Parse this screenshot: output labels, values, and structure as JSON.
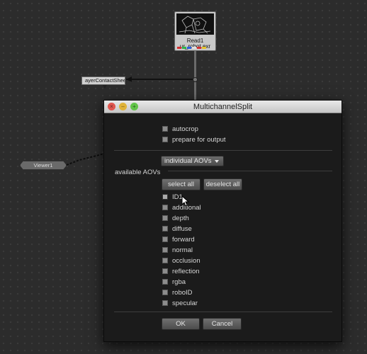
{
  "graph": {
    "read_node": {
      "name": "Read1",
      "file": "ur_robot.exr"
    },
    "contact_node": {
      "label": "ayerContactSheet"
    },
    "viewer_node": {
      "label": "Viewer1"
    },
    "channel_colors": [
      "#d23030",
      "#2fb64a",
      "#2b5fe0",
      "#e0e0e0",
      "#d23030",
      "#e6c42a"
    ]
  },
  "dialog": {
    "title": "MultichannelSplit",
    "options": [
      {
        "label": "autocrop",
        "checked": false
      },
      {
        "label": "prepare for output",
        "checked": false
      }
    ],
    "mode_dropdown": {
      "selected": "individual AOVs"
    },
    "section_label": "available AOVs",
    "select_all_label": "select all",
    "deselect_all_label": "deselect all",
    "aovs": [
      {
        "label": "ID1",
        "checked": false
      },
      {
        "label": "additional",
        "checked": false
      },
      {
        "label": "depth",
        "checked": false
      },
      {
        "label": "diffuse",
        "checked": false
      },
      {
        "label": "forward",
        "checked": false
      },
      {
        "label": "normal",
        "checked": false
      },
      {
        "label": "occlusion",
        "checked": false
      },
      {
        "label": "reflection",
        "checked": false
      },
      {
        "label": "rgba",
        "checked": false
      },
      {
        "label": "roboID",
        "checked": false
      },
      {
        "label": "specular",
        "checked": false
      }
    ],
    "ok_label": "OK",
    "cancel_label": "Cancel",
    "window_button_colors": [
      "#e0574f",
      "#e0b33a",
      "#62c449"
    ]
  }
}
